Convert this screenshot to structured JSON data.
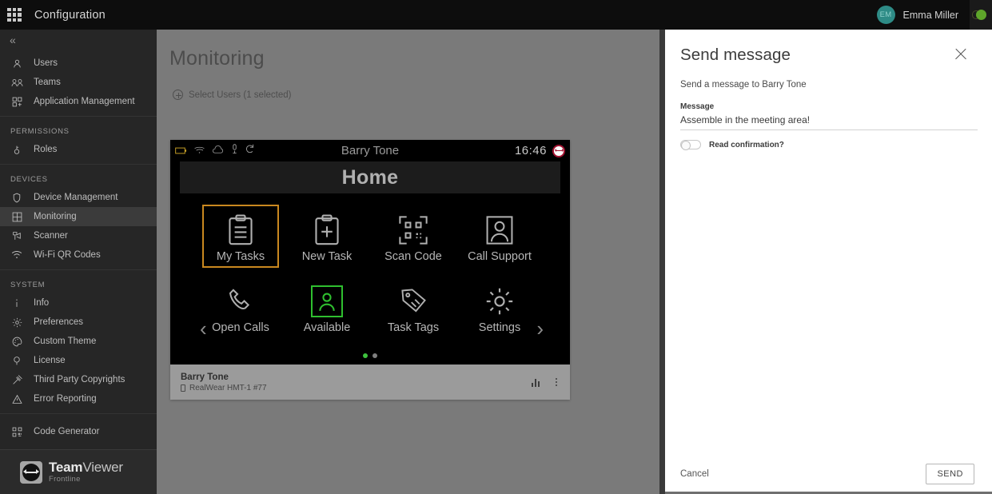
{
  "topbar": {
    "apps_icon": "grid-apps-icon",
    "title": "Configuration",
    "user_initials": "EM",
    "user_name": "Emma Miller",
    "support_icon": "support-status-icon"
  },
  "sidebar": {
    "collapse_icon": "chevron-double-left-icon",
    "groups": [
      {
        "label": "",
        "items": [
          {
            "label": "Users",
            "icon": "user-icon",
            "active": false
          },
          {
            "label": "Teams",
            "icon": "teams-icon",
            "active": false
          },
          {
            "label": "Application Management",
            "icon": "apps-manage-icon",
            "active": false
          }
        ]
      },
      {
        "label": "PERMISSIONS",
        "items": [
          {
            "label": "Roles",
            "icon": "key-icon",
            "active": false
          }
        ]
      },
      {
        "label": "DEVICES",
        "items": [
          {
            "label": "Device Management",
            "icon": "shield-icon",
            "active": false
          },
          {
            "label": "Monitoring",
            "icon": "grid-monitor-icon",
            "active": true
          },
          {
            "label": "Scanner",
            "icon": "scanner-icon",
            "active": false
          },
          {
            "label": "Wi-Fi QR Codes",
            "icon": "wifi-icon",
            "active": false
          }
        ]
      },
      {
        "label": "SYSTEM",
        "items": [
          {
            "label": "Info",
            "icon": "info-icon",
            "active": false
          },
          {
            "label": "Preferences",
            "icon": "gear-icon",
            "active": false
          },
          {
            "label": "Custom Theme",
            "icon": "palette-icon",
            "active": false
          },
          {
            "label": "License",
            "icon": "license-icon",
            "active": false
          },
          {
            "label": "Third Party Copyrights",
            "icon": "gavel-icon",
            "active": false
          },
          {
            "label": "Error Reporting",
            "icon": "warning-triangle-icon",
            "active": false
          }
        ]
      },
      {
        "label": "",
        "items": [
          {
            "label": "Code Generator",
            "icon": "qr-code-icon",
            "active": false
          }
        ]
      }
    ],
    "brand": {
      "name_bold": "Team",
      "name_light": "Viewer",
      "subtitle": "Frontline"
    }
  },
  "main": {
    "page_title": "Monitoring",
    "select_users_label": "Select Users (1 selected)",
    "device_screen": {
      "statusbar": {
        "icons": [
          "battery-icon",
          "wifi-icon",
          "cloud-icon",
          "microphone-icon",
          "sync-icon"
        ],
        "title": "Barry Tone",
        "time": "16:46",
        "badge_icon": "teamviewer-icon"
      },
      "header": "Home",
      "apps": [
        {
          "label": "My Tasks",
          "icon": "clipboard-list-icon",
          "selected": true,
          "highlight": "#c9881f"
        },
        {
          "label": "New Task",
          "icon": "clipboard-plus-icon",
          "selected": false
        },
        {
          "label": "Scan Code",
          "icon": "qr-scan-icon",
          "selected": false
        },
        {
          "label": "Call Support",
          "icon": "person-frame-icon",
          "selected": false
        },
        {
          "label": "Open Calls",
          "icon": "phone-icon",
          "selected": false
        },
        {
          "label": "Available",
          "icon": "person-available-icon",
          "selected": false,
          "highlight": "#2fbf2f"
        },
        {
          "label": "Task Tags",
          "icon": "tags-icon",
          "selected": false
        },
        {
          "label": "Settings",
          "icon": "gear-icon",
          "selected": false
        }
      ],
      "prev_arrow": "chevron-left-icon",
      "next_arrow": "chevron-right-icon",
      "page_dots": {
        "count": 2,
        "active_index": 0,
        "active_color": "#3ec23e",
        "inactive_color": "#7f7f7f"
      }
    },
    "device_card": {
      "name": "Barry Tone",
      "device_model": "RealWear HMT-1 #77",
      "device_icon": "phone-icon",
      "stats_icon": "bar-chart-icon",
      "menu_icon": "kebab-menu-icon"
    }
  },
  "panel": {
    "title": "Send message",
    "close_icon": "close-icon",
    "subtitle": "Send a message to Barry Tone",
    "message_label": "Message",
    "message_value": "Assemble in the meeting area!",
    "message_placeholder": "Message",
    "read_confirmation_label": "Read confirmation?",
    "read_confirmation_on": false,
    "cancel_label": "Cancel",
    "send_label": "SEND"
  }
}
